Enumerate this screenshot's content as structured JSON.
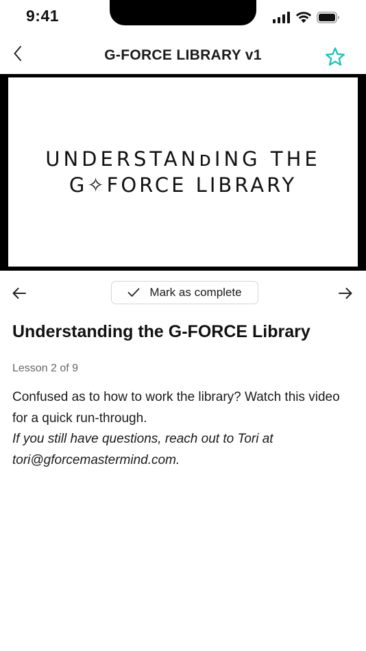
{
  "status_bar": {
    "time": "9:41"
  },
  "header": {
    "title": "G-FORCE LIBRARY v1",
    "back_icon": "chevron-left-icon",
    "favorite_icon": "star-outline-icon",
    "accent_color": "#1fc6b6"
  },
  "video": {
    "line1": "UNDERSTANᴅING THE",
    "line2": "G✧FORCE LIBRARY"
  },
  "lesson_nav": {
    "prev_icon": "arrow-left-icon",
    "next_icon": "arrow-right-icon",
    "complete_label": "Mark as complete",
    "complete_icon": "checkmark-icon"
  },
  "lesson": {
    "title": "Understanding the G-FORCE Library",
    "count": "Lesson 2 of 9",
    "description": "Confused as to how to work the library? Watch this video for a quick run-through.",
    "note": "If you still have questions, reach out to Tori at tori@gforcemastermind.com."
  }
}
